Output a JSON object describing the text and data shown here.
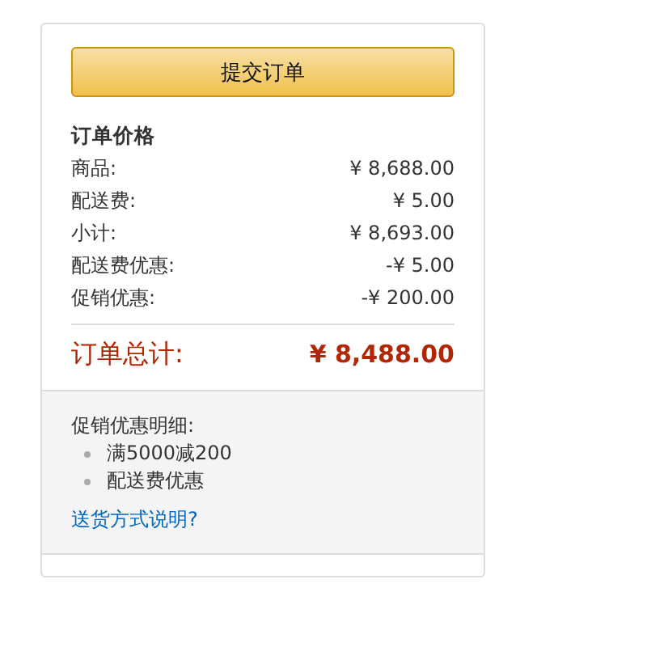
{
  "submit_button": "提交订单",
  "price_section": {
    "title": "订单价格",
    "rows": [
      {
        "label": "商品:",
        "value": "¥ 8,688.00"
      },
      {
        "label": "配送费:",
        "value": "¥ 5.00"
      },
      {
        "label": "小计:",
        "value": "¥ 8,693.00"
      },
      {
        "label": "配送费优惠:",
        "value": "-¥ 5.00"
      },
      {
        "label": "促销优惠:",
        "value": "-¥ 200.00"
      }
    ],
    "total": {
      "label": "订单总计:",
      "value": "¥ 8,488.00"
    }
  },
  "promotions": {
    "title": "促销优惠明细:",
    "items": [
      "满5000减200",
      "配送费优惠"
    ],
    "link": "送货方式说明?"
  }
}
